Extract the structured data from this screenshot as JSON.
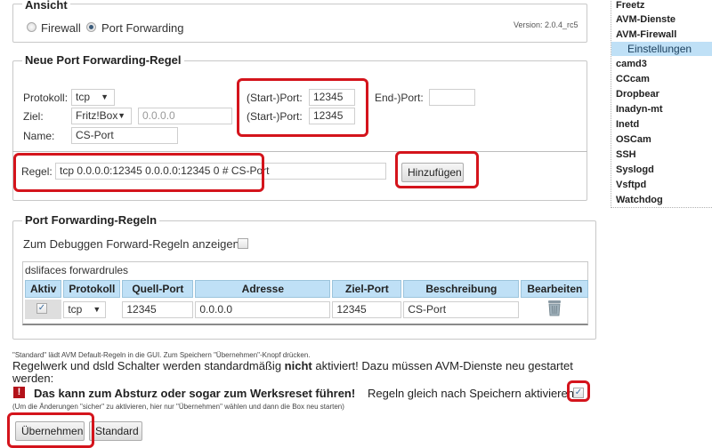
{
  "ansicht": {
    "legend": "Ansicht",
    "radio_firewall": "Firewall",
    "radio_port_forwarding": "Port Forwarding",
    "selected": "Port Forwarding",
    "version": "Version: 2.0.4_rc5"
  },
  "sidebar": {
    "items": [
      {
        "label": "Freetz"
      },
      {
        "label": "AVM-Dienste"
      },
      {
        "label": "AVM-Firewall"
      },
      {
        "label": "Einstellungen",
        "active": true
      },
      {
        "label": "camd3"
      },
      {
        "label": "CCcam"
      },
      {
        "label": "Dropbear"
      },
      {
        "label": "Inadyn-mt"
      },
      {
        "label": "Inetd"
      },
      {
        "label": "OSCam"
      },
      {
        "label": "SSH"
      },
      {
        "label": "Syslogd"
      },
      {
        "label": "Vsftpd"
      },
      {
        "label": "Watchdog"
      }
    ]
  },
  "new_rule": {
    "legend": "Neue Port Forwarding-Regel",
    "protokoll_label": "Protokoll:",
    "protokoll_value": "tcp",
    "ziel_label": "Ziel:",
    "ziel_value": "Fritz!Box",
    "ziel_ip_placeholder": "0.0.0.0",
    "name_label": "Name:",
    "name_value": "CS-Port",
    "start_port_label_1": "(Start-)Port:",
    "start_port_value_1": "12345",
    "end_port_label": "End-)Port:",
    "end_port_value": "",
    "start_port_label_2": "(Start-)Port:",
    "start_port_value_2": "12345",
    "regel_label": "Regel:",
    "regel_value": "tcp 0.0.0.0:12345 0.0.0.0:12345 0 # CS-Port",
    "add_button": "Hinzufügen"
  },
  "rules": {
    "legend": "Port Forwarding-Regeln",
    "debug_label": "Zum Debuggen Forward-Regeln anzeigen:",
    "debug_checked": false,
    "table_caption": "dslifaces forwardrules",
    "columns": [
      "Aktiv",
      "Protokoll",
      "Quell-Port",
      "Adresse",
      "Ziel-Port",
      "Beschreibung",
      "Bearbeiten"
    ],
    "rows": [
      {
        "aktiv": true,
        "protokoll": "tcp",
        "quell_port": "12345",
        "adresse": "0.0.0.0",
        "ziel_port": "12345",
        "beschreibung": "CS-Port",
        "action_icon": "trash-icon"
      }
    ]
  },
  "footer": {
    "note_standard": "\"Standard\" lädt AVM Default-Regeln in die GUI. Zum Speichern \"Übernehmen\"-Knopf drücken.",
    "warning_pre": "Regelwerk und dsld Schalter werden standardmäßig ",
    "warning_bold": "nicht",
    "warning_post": " aktiviert! Dazu müssen AVM-Dienste neu gestartet werden:",
    "danger_text": "Das kann zum Absturz oder sogar zum Werksreset führen!",
    "activate_label": "Regeln gleich nach Speichern aktivieren",
    "activate_checked": true,
    "hint": "(Um die Änderungen \"sicher\" zu aktivieren, hier nur \"Übernehmen\" wählen und dann die Box neu starten)",
    "apply_button": "Übernehmen",
    "standard_button": "Standard"
  }
}
